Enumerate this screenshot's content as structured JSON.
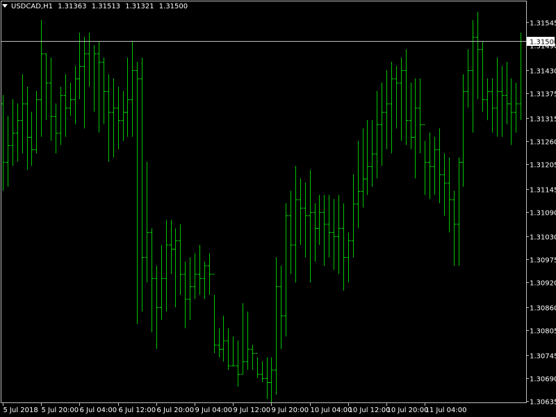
{
  "header": {
    "symbol": "USDCAD,H1",
    "open": "1.31363",
    "high": "1.31513",
    "low": "1.31321",
    "close": "1.31500"
  },
  "colors": {
    "background": "#000000",
    "bar": "#00c800",
    "axis": "#c0c0c0",
    "text": "#ffffff",
    "bid_line": "#c0c0c0",
    "bid_label_bg": "#ffffff",
    "bid_label_text": "#000000"
  },
  "chart_data": {
    "type": "ohlc",
    "title": "",
    "ylim": [
      1.3063,
      1.3159
    ],
    "yticks": [
      "1.31545",
      "1.31490",
      "1.31430",
      "1.31375",
      "1.31315",
      "1.31260",
      "1.31205",
      "1.31145",
      "1.31090",
      "1.31030",
      "1.30975",
      "1.30920",
      "1.30860",
      "1.30805",
      "1.30745",
      "1.30690",
      "1.30635"
    ],
    "xticks": [
      "5 Jul 2018",
      "5 Jul 20:00",
      "6 Jul 04:00",
      "6 Jul 12:00",
      "6 Jul 20:00",
      "9 Jul 04:00",
      "9 Jul 12:00",
      "9 Jul 20:00",
      "10 Jul 04:00",
      "10 Jul 12:00",
      "10 Jul 20:00",
      "11 Jul 04:00"
    ],
    "current_price": "1.31500",
    "bars": [
      [
        1.3135,
        1.3137,
        1.3114,
        1.3121
      ],
      [
        1.3121,
        1.3132,
        1.3115,
        1.3125
      ],
      [
        1.3125,
        1.3136,
        1.312,
        1.3128
      ],
      [
        1.3128,
        1.3135,
        1.3121,
        1.3131
      ],
      [
        1.3131,
        1.3142,
        1.3123,
        1.3135
      ],
      [
        1.3135,
        1.3139,
        1.3119,
        1.3127
      ],
      [
        1.3127,
        1.3133,
        1.312,
        1.3124
      ],
      [
        1.3124,
        1.3138,
        1.3123,
        1.3136
      ],
      [
        1.3136,
        1.3155,
        1.3127,
        1.3147
      ],
      [
        1.3147,
        1.3147,
        1.3131,
        1.314
      ],
      [
        1.314,
        1.3146,
        1.3126,
        1.3132
      ],
      [
        1.3132,
        1.3135,
        1.3123,
        1.3128
      ],
      [
        1.3128,
        1.3139,
        1.3125,
        1.3137
      ],
      [
        1.3137,
        1.3142,
        1.3127,
        1.3134
      ],
      [
        1.3134,
        1.314,
        1.3132,
        1.3136
      ],
      [
        1.3136,
        1.3144,
        1.313,
        1.3141
      ],
      [
        1.3141,
        1.3152,
        1.3136,
        1.3144
      ],
      [
        1.3144,
        1.3151,
        1.3129,
        1.3147
      ],
      [
        1.3147,
        1.3152,
        1.3139,
        1.315
      ],
      [
        1.315,
        1.3149,
        1.3133,
        1.3147
      ],
      [
        1.3147,
        1.315,
        1.3128,
        1.3145
      ],
      [
        1.3145,
        1.3146,
        1.313,
        1.3138
      ],
      [
        1.3138,
        1.3142,
        1.3121,
        1.3133
      ],
      [
        1.3133,
        1.3141,
        1.3122,
        1.3134
      ],
      [
        1.3134,
        1.3139,
        1.3124,
        1.3131
      ],
      [
        1.3131,
        1.3138,
        1.3126,
        1.3133
      ],
      [
        1.3133,
        1.3146,
        1.3127,
        1.3136
      ],
      [
        1.3136,
        1.315,
        1.3127,
        1.3143
      ],
      [
        1.3143,
        1.3145,
        1.3082,
        1.3141
      ],
      [
        1.3141,
        1.3146,
        1.3085,
        1.3098
      ],
      [
        1.3098,
        1.3121,
        1.3092,
        1.3104
      ],
      [
        1.3104,
        1.3105,
        1.308,
        1.3093
      ],
      [
        1.3093,
        1.3096,
        1.3076,
        1.3086
      ],
      [
        1.3086,
        1.3101,
        1.3083,
        1.3093
      ],
      [
        1.3093,
        1.3107,
        1.3085,
        1.3101
      ],
      [
        1.3101,
        1.3107,
        1.3094,
        1.31
      ],
      [
        1.31,
        1.3105,
        1.3086,
        1.3102
      ],
      [
        1.3102,
        1.3106,
        1.3089,
        1.3094
      ],
      [
        1.3094,
        1.3097,
        1.3081,
        1.3088
      ],
      [
        1.3088,
        1.3098,
        1.3083,
        1.3091
      ],
      [
        1.3091,
        1.3099,
        1.3088,
        1.3094
      ],
      [
        1.3094,
        1.3101,
        1.3089,
        1.3093
      ],
      [
        1.3093,
        1.3097,
        1.3088,
        1.3096
      ],
      [
        1.3096,
        1.3099,
        1.3089,
        1.3094
      ],
      [
        1.3094,
        1.3089,
        1.3075,
        1.3077
      ],
      [
        1.3077,
        1.3081,
        1.3074,
        1.3076
      ],
      [
        1.3076,
        1.3084,
        1.3073,
        1.3078
      ],
      [
        1.3078,
        1.3081,
        1.3071,
        1.3072
      ],
      [
        1.3072,
        1.3079,
        1.3072,
        1.3072
      ],
      [
        1.3072,
        1.3078,
        1.3067,
        1.307
      ],
      [
        1.307,
        1.3087,
        1.307,
        1.3073
      ],
      [
        1.3073,
        1.3085,
        1.3071,
        1.3076
      ],
      [
        1.3076,
        1.3077,
        1.3071,
        1.3075
      ],
      [
        1.3075,
        1.3074,
        1.3069,
        1.307
      ],
      [
        1.307,
        1.3073,
        1.3068,
        1.3069
      ],
      [
        1.3069,
        1.3074,
        1.3064,
        1.3068
      ],
      [
        1.3068,
        1.3074,
        1.3063,
        1.3071
      ],
      [
        1.3071,
        1.3098,
        1.3065,
        1.3091
      ],
      [
        1.3091,
        1.3096,
        1.3076,
        1.3084
      ],
      [
        1.3084,
        1.3111,
        1.3079,
        1.3108
      ],
      [
        1.3108,
        1.3114,
        1.3094,
        1.3101
      ],
      [
        1.3101,
        1.312,
        1.3092,
        1.3112
      ],
      [
        1.3112,
        1.3117,
        1.3101,
        1.311
      ],
      [
        1.311,
        1.3116,
        1.3098,
        1.3108
      ],
      [
        1.3108,
        1.3119,
        1.3092,
        1.3109
      ],
      [
        1.3109,
        1.3111,
        1.3097,
        1.3105
      ],
      [
        1.3105,
        1.3113,
        1.3101,
        1.3109
      ],
      [
        1.3109,
        1.3113,
        1.3096,
        1.3106
      ],
      [
        1.3106,
        1.3113,
        1.3098,
        1.3104
      ],
      [
        1.3104,
        1.3112,
        1.3095,
        1.3103
      ],
      [
        1.3103,
        1.3113,
        1.3094,
        1.3105
      ],
      [
        1.3105,
        1.3111,
        1.309,
        1.3098
      ],
      [
        1.3098,
        1.3104,
        1.3092,
        1.3102
      ],
      [
        1.3102,
        1.3118,
        1.3098,
        1.3111
      ],
      [
        1.3111,
        1.3126,
        1.3105,
        1.3114
      ],
      [
        1.3114,
        1.3129,
        1.311,
        1.3117
      ],
      [
        1.3117,
        1.3131,
        1.3113,
        1.312
      ],
      [
        1.312,
        1.3131,
        1.3115,
        1.3123
      ],
      [
        1.3123,
        1.3138,
        1.3117,
        1.313
      ],
      [
        1.313,
        1.314,
        1.312,
        1.3133
      ],
      [
        1.3133,
        1.3143,
        1.3124,
        1.3135
      ],
      [
        1.3135,
        1.3145,
        1.3123,
        1.3141
      ],
      [
        1.3141,
        1.3144,
        1.3129,
        1.314
      ],
      [
        1.314,
        1.3146,
        1.3126,
        1.3143
      ],
      [
        1.3143,
        1.3148,
        1.3125,
        1.3131
      ],
      [
        1.3131,
        1.314,
        1.3124,
        1.3127
      ],
      [
        1.3127,
        1.3141,
        1.3117,
        1.3134
      ],
      [
        1.3134,
        1.3141,
        1.3123,
        1.313
      ],
      [
        1.313,
        1.3126,
        1.3113,
        1.3121
      ],
      [
        1.3121,
        1.3128,
        1.3112,
        1.312
      ],
      [
        1.312,
        1.3127,
        1.3113,
        1.3124
      ],
      [
        1.3124,
        1.3129,
        1.3111,
        1.3118
      ],
      [
        1.3118,
        1.3123,
        1.3108,
        1.3116
      ],
      [
        1.3116,
        1.3122,
        1.3104,
        1.3112
      ],
      [
        1.3112,
        1.3114,
        1.3096,
        1.3106
      ],
      [
        1.3106,
        1.3122,
        1.3096,
        1.3121
      ],
      [
        1.3121,
        1.3142,
        1.3115,
        1.3138
      ],
      [
        1.3138,
        1.3148,
        1.3134,
        1.3143
      ],
      [
        1.3143,
        1.3155,
        1.3128,
        1.3151
      ],
      [
        1.3151,
        1.3157,
        1.3136,
        1.3148
      ],
      [
        1.3148,
        1.315,
        1.3133,
        1.3136
      ],
      [
        1.3136,
        1.3141,
        1.3131,
        1.3138
      ],
      [
        1.3138,
        1.3141,
        1.3128,
        1.3134
      ],
      [
        1.3134,
        1.3146,
        1.3127,
        1.3138
      ],
      [
        1.3138,
        1.3144,
        1.3127,
        1.3137
      ],
      [
        1.3137,
        1.3145,
        1.313,
        1.3135
      ],
      [
        1.3135,
        1.3141,
        1.3125,
        1.3133
      ],
      [
        1.3133,
        1.314,
        1.3128,
        1.3135
      ],
      [
        1.3135,
        1.3152,
        1.3131,
        1.315
      ]
    ]
  }
}
